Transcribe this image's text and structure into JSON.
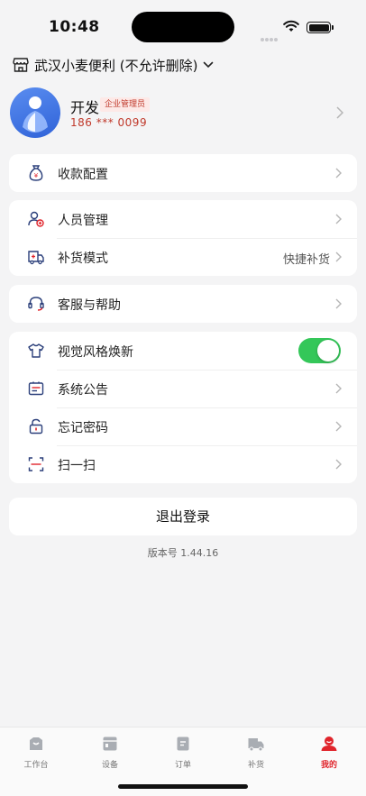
{
  "status": {
    "time": "10:48"
  },
  "store": {
    "name": "武汉小麦便利 (不允许删除)"
  },
  "profile": {
    "name": "开发",
    "role": "企业管理员",
    "phone": "186 *** 0099"
  },
  "menu": {
    "payment_config": "收款配置",
    "staff_management": "人员管理",
    "restock_mode": {
      "label": "补货模式",
      "value": "快捷补货"
    },
    "support": "客服与帮助",
    "visual_refresh": {
      "label": "视觉风格焕新",
      "enabled": true
    },
    "announcements": "系统公告",
    "forgot_password": "忘记密码",
    "scan": "扫一扫"
  },
  "logout_label": "退出登录",
  "version": "版本号 1.44.16",
  "tabs": [
    {
      "label": "工作台",
      "icon": "workbench-icon"
    },
    {
      "label": "设备",
      "icon": "device-icon"
    },
    {
      "label": "订单",
      "icon": "order-icon"
    },
    {
      "label": "补货",
      "icon": "truck-icon"
    },
    {
      "label": "我的",
      "icon": "profile-icon",
      "active": true
    }
  ],
  "colors": {
    "accent": "#e0242b",
    "toggle_on": "#34c759",
    "icon_blue": "#2b3f7a"
  }
}
